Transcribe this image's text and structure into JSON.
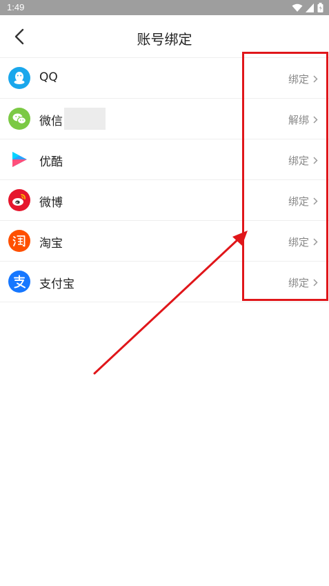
{
  "status_bar": {
    "time": "1:49"
  },
  "header": {
    "title": "账号绑定"
  },
  "accounts": [
    {
      "name": "QQ",
      "action": "绑定",
      "icon": "qq-icon",
      "color": "#1aa7ec"
    },
    {
      "name": "微信",
      "action": "解绑",
      "icon": "wechat-icon",
      "color": "#7bc944"
    },
    {
      "name": "优酷",
      "action": "绑定",
      "icon": "youku-icon",
      "color": "#2aa1ff"
    },
    {
      "name": "微博",
      "action": "绑定",
      "icon": "weibo-icon",
      "color": "#e6162d"
    },
    {
      "name": "淘宝",
      "action": "绑定",
      "icon": "taobao-icon",
      "color": "#ff5000"
    },
    {
      "name": "支付宝",
      "action": "绑定",
      "icon": "alipay-icon",
      "color": "#1677ff"
    }
  ],
  "annotation": {
    "color": "#e0161a"
  }
}
